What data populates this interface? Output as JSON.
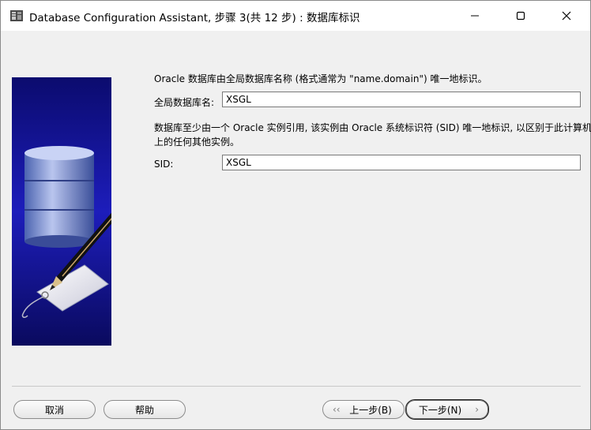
{
  "window": {
    "title": "Database Configuration Assistant, 步骤 3(共 12 步) : 数据库标识"
  },
  "intro_text": "Oracle 数据库由全局数据库名称 (格式通常为 \"name.domain\") 唯一地标识。",
  "global_db": {
    "label": "全局数据库名:",
    "value": "XSGL"
  },
  "sid_description": {
    "line1": "数据库至少由一个 Oracle 实例引用, 该实例由 Oracle 系统标识符 (SID) 唯一地标识, 以区别于此计算机",
    "line2": "上的任何其他实例。"
  },
  "sid": {
    "label": "SID:",
    "value": "XSGL"
  },
  "buttons": {
    "cancel": "取消",
    "help": "帮助",
    "back": "上一步(B)",
    "next": "下一步(N)"
  },
  "colors": {
    "art_blue": "#1a1aa8",
    "art_dark": "#05054a"
  }
}
